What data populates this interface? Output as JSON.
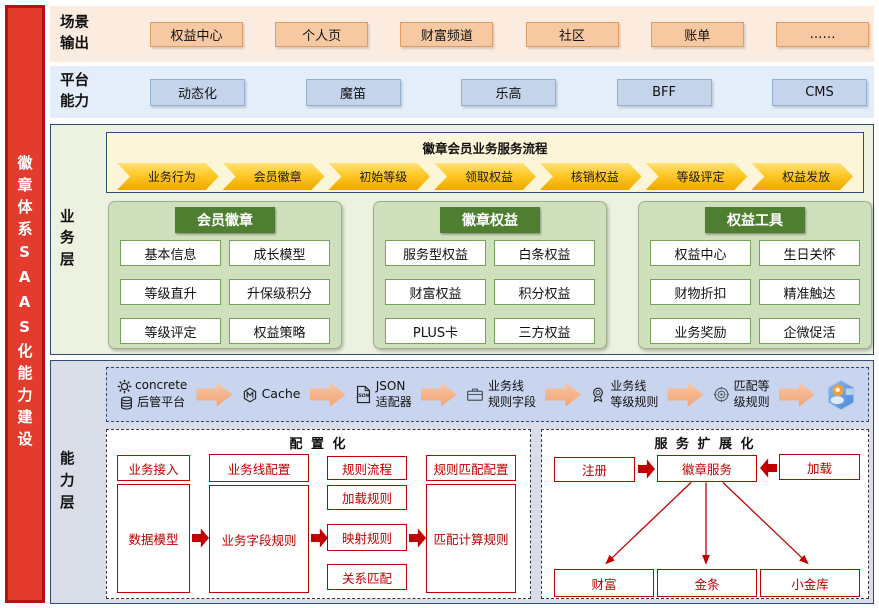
{
  "sidebar": {
    "title": "徽章体系SAAS化能力建设"
  },
  "scene_row": {
    "label": "场景输出",
    "items": [
      "权益中心",
      "个人页",
      "财富频道",
      "社区",
      "账单",
      "……"
    ]
  },
  "platform_row": {
    "label": "平台能力",
    "items": [
      "动态化",
      "魔笛",
      "乐高",
      "BFF",
      "CMS"
    ]
  },
  "business_layer": {
    "label": "业务层",
    "process": {
      "title": "徽章会员业务服务流程",
      "steps": [
        "业务行为",
        "会员徽章",
        "初始等级",
        "领取权益",
        "核销权益",
        "等级评定",
        "权益发放"
      ]
    },
    "panels": [
      {
        "title": "会员徽章",
        "items": [
          "基本信息",
          "成长模型",
          "等级直升",
          "升保级积分",
          "等级评定",
          "权益策略"
        ]
      },
      {
        "title": "徽章权益",
        "items": [
          "服务型权益",
          "白条权益",
          "财富权益",
          "积分权益",
          "PLUS卡",
          "三方权益"
        ]
      },
      {
        "title": "权益工具",
        "items": [
          "权益中心",
          "生日关怀",
          "财物折扣",
          "精准触达",
          "业务奖励",
          "企微促活"
        ]
      }
    ]
  },
  "capability_layer": {
    "label": "能力层",
    "pipeline": {
      "step1": {
        "row1": {
          "icon": "gear-icon",
          "text": "concrete"
        },
        "row2": {
          "icon": "database-icon",
          "text": "后管平台"
        }
      },
      "step2": {
        "icon": "cache-hexagon-icon",
        "text": "Cache"
      },
      "step3": {
        "icon": "json-file-icon",
        "line1": "JSON",
        "line2": "适配器"
      },
      "step4": {
        "icon": "briefcase-icon",
        "line1": "业务线",
        "line2": "规则字段"
      },
      "step5": {
        "icon": "medal-icon",
        "line1": "业务线",
        "line2": "等级规则"
      },
      "step6": {
        "icon": "target-icon",
        "line1": "匹配等",
        "line2": "级规则"
      },
      "step7": {
        "icon": "app-hexagon-icon"
      }
    },
    "config_box": {
      "title": "配 置 化",
      "col1_top": "业务接入",
      "col1_main": "数据模型",
      "col2_top": "业务线配置",
      "col2_main": "业务字段规则",
      "col3_items": [
        "规则流程",
        "加载规则",
        "映射规则",
        "关系匹配"
      ],
      "col4_top": "规则匹配配置",
      "col4_main": "匹配计算规则"
    },
    "service_box": {
      "title": "服 务 扩 展 化",
      "left": "注册",
      "center": "徽章服务",
      "right": "加载",
      "bottom": [
        "财富",
        "金条",
        "小金库"
      ]
    }
  },
  "colors": {
    "sidebar_red": "#e33c2e",
    "accent_navy": "#2e4d7b",
    "process_gold": "#ffc000",
    "panel_green_header": "#4e7e2f",
    "red_accent": "#c00000",
    "pipeline_arrow_orange": "#f2a679"
  }
}
